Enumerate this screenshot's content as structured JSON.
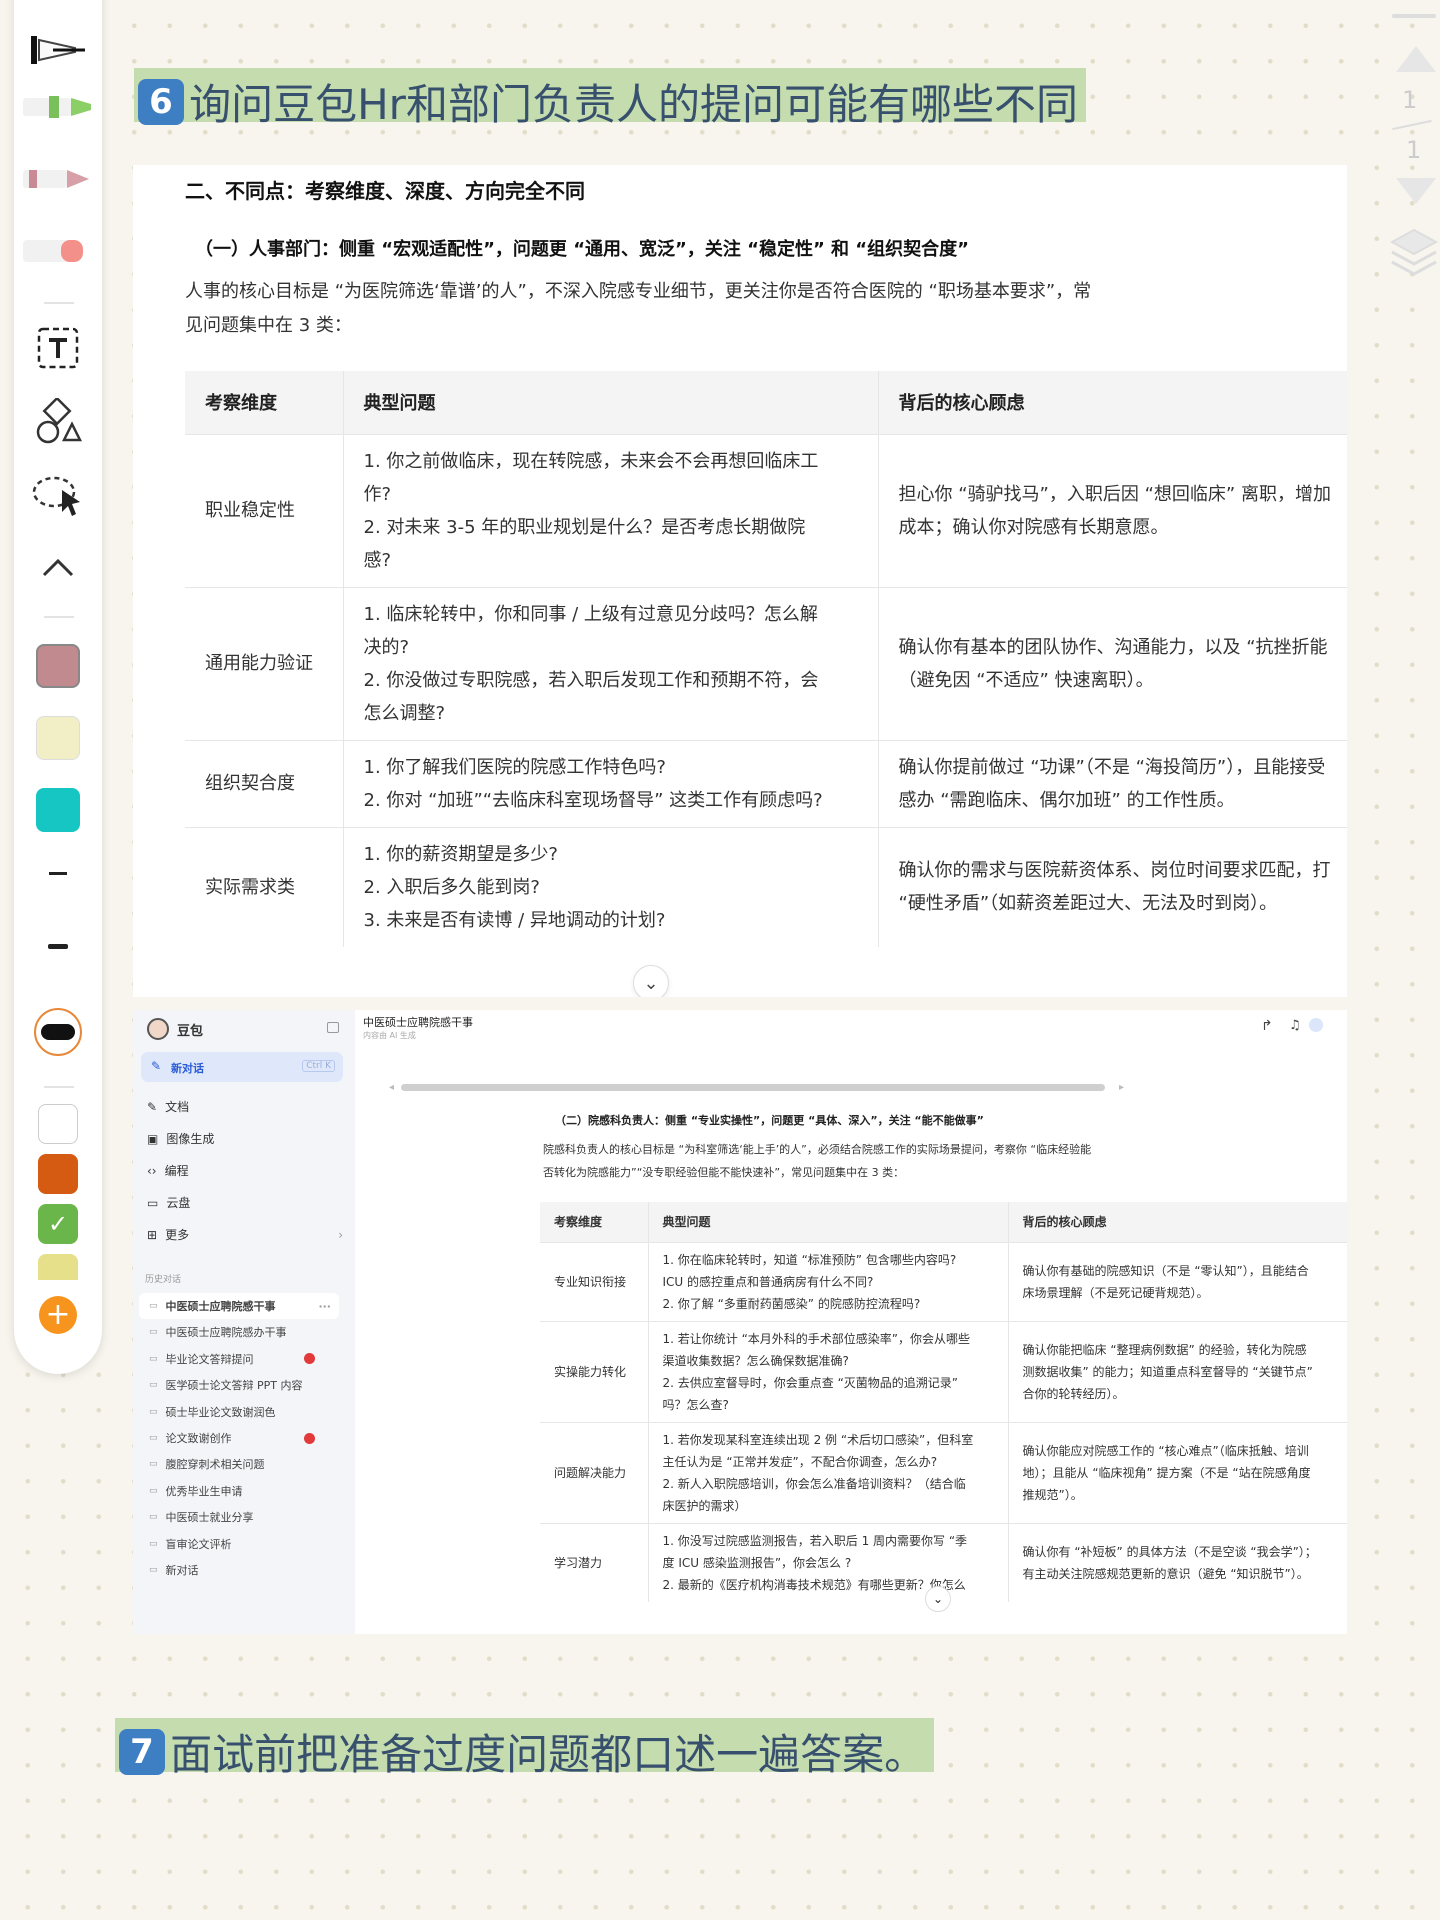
{
  "colors": {
    "heading_highlight": "#c5dcae",
    "number_badge": "#3e7fc4",
    "heading_text": "#37506e"
  },
  "toolbar": {
    "icons": [
      "pen-icon",
      "green-marker-icon",
      "pink-marker-icon",
      "eraser-icon",
      "text-tool-icon",
      "shapes-icon",
      "lasso-select-icon",
      "chevron-up-icon",
      "thin-line-icon",
      "medium-line-icon",
      "thick-line-icon",
      "add-icon"
    ],
    "swatches": [
      "#c08a8f",
      "#f2efc7",
      "#16c6c2",
      "#ffffff",
      "#d55a12",
      "#6ab64a",
      "#e6e08a"
    ]
  },
  "pager": {
    "current": "1",
    "total": "1"
  },
  "section6": {
    "num": "6",
    "title": "询问豆包Hr和部门负责人的提问可能有哪些不同"
  },
  "section7": {
    "num": "7",
    "title": "面试前把准备过度问题都口述一遍答案。"
  },
  "shot1": {
    "heading": "二、不同点：考察维度、深度、方向完全不同",
    "subheading": "（一）人事部门：侧重 “宏观适配性”，问题更 “通用、宽泛”，关注 “稳定性” 和 “组织契合度”",
    "intro_line1": "人事的核心目标是 “为医院筛选‘靠谱’的人”，不深入院感专业细节，更关注你是否符合医院的 “职场基本要求”，常",
    "intro_line2": "见问题集中在 3 类：",
    "headers": [
      "考察维度",
      "典型问题",
      "背后的核心顾虑"
    ],
    "rows": [
      {
        "dim": "职业稳定性",
        "q": [
          "1. 你之前做临床，现在转院感，未来会不会再想回临床工",
          "作?",
          "2. 对未来 3-5 年的职业规划是什么？是否考虑长期做院",
          "感?"
        ],
        "c": [
          "担心你 “骑驴找马”，入职后因 “想回临床” 离职，增加",
          "成本；确认你对院感有长期意愿。"
        ]
      },
      {
        "dim": "通用能力验证",
        "q": [
          "1. 临床轮转中，你和同事 / 上级有过意见分歧吗？怎么解",
          "决的?",
          "2. 你没做过专职院感，若入职后发现工作和预期不符，会",
          "怎么调整?"
        ],
        "c": [
          "确认你有基本的团队协作、沟通能力，以及 “抗挫折能",
          "（避免因 “不适应” 快速离职）。"
        ]
      },
      {
        "dim": "组织契合度",
        "q": [
          "1. 你了解我们医院的院感工作特色吗?",
          "2. 你对 “加班”“去临床科室现场督导” 这类工作有顾虑吗?"
        ],
        "c": [
          "确认你提前做过 “功课”（不是 “海投简历”），且能接受",
          "感办 “需跑临床、偶尔加班” 的工作性质。"
        ]
      },
      {
        "dim": "实际需求类",
        "q": [
          "1. 你的薪资期望是多少?",
          "2. 入职后多久能到岗?",
          "3. 未来是否有读博 / 异地调动的计划?"
        ],
        "c": [
          "确认你的需求与医院薪资体系、岗位时间要求匹配，打",
          "“硬性矛盾”（如薪资差距过大、无法及时到岗）。"
        ]
      }
    ]
  },
  "shot2": {
    "app_name": "豆包",
    "new_chat": "新对话",
    "new_chat_shortcut": "Ctrl K",
    "menu": [
      "文档",
      "图像生成",
      "编程",
      "云盘",
      "更多"
    ],
    "history_label": "历史对话",
    "history": [
      "中医硕士应聘院感干事",
      "中医硕士应聘院感办干事",
      "毕业论文答辩提问",
      "医学硕士论文答辩 PPT 内容",
      "硕士毕业论文致谢润色",
      "论文致谢创作",
      "腹腔穿刺术相关问题",
      "优秀毕业生申请",
      "中医硕士就业分享",
      "盲审论文评析",
      "新对话"
    ],
    "chat_title": "中医硕士应聘院感干事",
    "chat_note": "内容由 AI 生成",
    "subheading": "（二）院感科负责人：侧重 “专业实操性”，问题更 “具体、深入”，关注 “能不能做事”",
    "intro_line1": "院感科负责人的核心目标是 “为科室筛选‘能上手’的人”，必须结合院感工作的实际场景提问，考察你 “临床经验能",
    "intro_line2": "否转化为院感能力”“没专职经验但能不能快速补”，常见问题集中在 3 类：",
    "headers": [
      "考察维度",
      "典型问题",
      "背后的核心顾虑"
    ],
    "rows": [
      {
        "dim": "专业知识衔接",
        "q": [
          "1. 你在临床轮转时，知道 “标准预防” 包含哪些内容吗?",
          "ICU 的感控重点和普通病房有什么不同?",
          "2. 你了解 “多重耐药菌感染” 的院感防控流程吗?"
        ],
        "c": [
          "确认你有基础的院感知识（不是 “零认知”），且能结合",
          "床场景理解（不是死记硬背规范）。"
        ]
      },
      {
        "dim": "实操能力转化",
        "q": [
          "1. 若让你统计 “本月外科的手术部位感染率”，你会从哪些",
          "渠道收集数据？怎么确保数据准确?",
          "2. 去供应室督导时，你会重点查 “灭菌物品的追溯记录”",
          "吗？怎么查?"
        ],
        "c": [
          "确认你能把临床 “整理病例数据” 的经验，转化为院感",
          "测数据收集” 的能力；知道重点科室督导的 “关键节点”",
          "合你的轮转经历）。"
        ]
      },
      {
        "dim": "问题解决能力",
        "q": [
          "1. 若你发现某科室连续出现 2 例 “术后切口感染”，但科室",
          "主任认为是 “正常并发症”，不配合你调查，怎么办?",
          "2. 新人入职院感培训，你会怎么准备培训资料？（结合临",
          "床医护的需求）"
        ],
        "c": [
          "确认你能应对院感工作的 “核心难点”（临床抵触、培训",
          "地）；且能从 “临床视角” 提方案（不是 “站在院感角度",
          "推规范”）。"
        ]
      },
      {
        "dim": "学习潜力",
        "q": [
          "1. 你没写过院感监测报告，若入职后 1 周内需要你写 “季",
          "度 ICU 感染监测报告”，你会怎么 ?",
          "2. 最新的《医疗机构消毒技术规范》有哪些更新？你怎么"
        ],
        "c": [
          "确认你有 “补短板” 的具体方法（不是空谈 “我会学”）；",
          "有主动关注院感规范更新的意识（避免 “知识脱节”）。"
        ]
      }
    ]
  }
}
